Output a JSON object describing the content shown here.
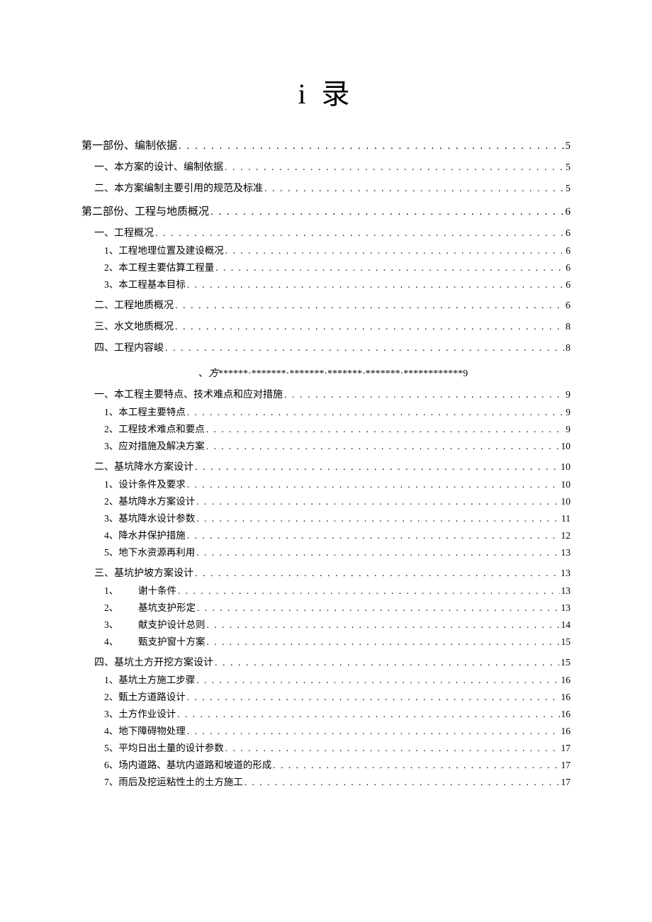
{
  "title": "i 录",
  "entries": [
    {
      "level": 0,
      "label": "第一部份、编制依据",
      "page": "5"
    },
    {
      "level": 1,
      "label": "一、本方案的设计、编制依据",
      "page": "5"
    },
    {
      "level": 1,
      "label": "二、本方案编制主要引用的规范及标准",
      "page": "5"
    },
    {
      "level": 0,
      "label": "第二部份、工程与地质概况",
      "page": "6"
    },
    {
      "level": 1,
      "label": "一、工程概况",
      "page": "6"
    },
    {
      "level": 2,
      "label": "1、工程地理位置及建设概况",
      "page": "6"
    },
    {
      "level": 2,
      "label": "2、本工程主要估算工程量",
      "page": "6"
    },
    {
      "level": 2,
      "label": "3、本工程基本目标",
      "page": "6"
    },
    {
      "level": 1,
      "label": "二、工程地质概况",
      "page": "6"
    },
    {
      "level": 1,
      "label": "三、水文地质概况",
      "page": "8"
    },
    {
      "level": 1,
      "label": "四、工程内容峻",
      "page": "8"
    },
    {
      "level": -1,
      "label": "、方******·*******·*******·*******·*******·************9",
      "page": ""
    },
    {
      "level": 1,
      "label": "一、本工程主要特点、技术难点和应对措施",
      "page": "9"
    },
    {
      "level": 2,
      "label": "1、本工程主要特点",
      "page": "9"
    },
    {
      "level": 2,
      "label": "2、工程技术难点和要点",
      "page": "9"
    },
    {
      "level": 2,
      "label": "3、应对措施及解决方案",
      "page": "10"
    },
    {
      "level": 1,
      "label": "二、基坑降水方案设计",
      "page": "10"
    },
    {
      "level": 2,
      "label": "1、设计条件及要求",
      "page": "10"
    },
    {
      "level": 2,
      "label": "2、基坑降水方案设计",
      "page": "10"
    },
    {
      "level": 2,
      "label": "3、基坑降水设计参数",
      "page": "11"
    },
    {
      "level": 2,
      "label": "4、降水井保护措施",
      "page": "12"
    },
    {
      "level": 2,
      "label": "5、地下水资源再利用",
      "page": "13"
    },
    {
      "level": 1,
      "label": "三、基坑护坡方案设计",
      "page": "13"
    },
    {
      "level": 3,
      "num": "1、",
      "label": "谢十条件",
      "page": "13"
    },
    {
      "level": 3,
      "num": "2、",
      "label": "基坑支护形定",
      "page": "13"
    },
    {
      "level": 3,
      "num": "3、",
      "label": "献支护设计总则",
      "page": "14"
    },
    {
      "level": 3,
      "num": "4、",
      "label": "甄支护窗十方案",
      "page": "15"
    },
    {
      "level": 1,
      "label": "四、基坑土方开挖方案设计",
      "page": "15"
    },
    {
      "level": 2,
      "label": "1、基坑土方施工步骤",
      "page": "16"
    },
    {
      "level": 2,
      "label": "2、甄土方道路设计",
      "page": "16"
    },
    {
      "level": 2,
      "label": "3、土方作业设计",
      "page": "16"
    },
    {
      "level": 2,
      "label": "4、地下障碍物处理",
      "page": "16"
    },
    {
      "level": 2,
      "label": "5、平均日出土量的设计参数",
      "page": "17"
    },
    {
      "level": 2,
      "label": "6、场内道路、基坑内道路和坡道的形成",
      "page": "17"
    },
    {
      "level": 2,
      "label": "7、雨后及挖运粘性土的土方施工",
      "page": "17"
    }
  ]
}
